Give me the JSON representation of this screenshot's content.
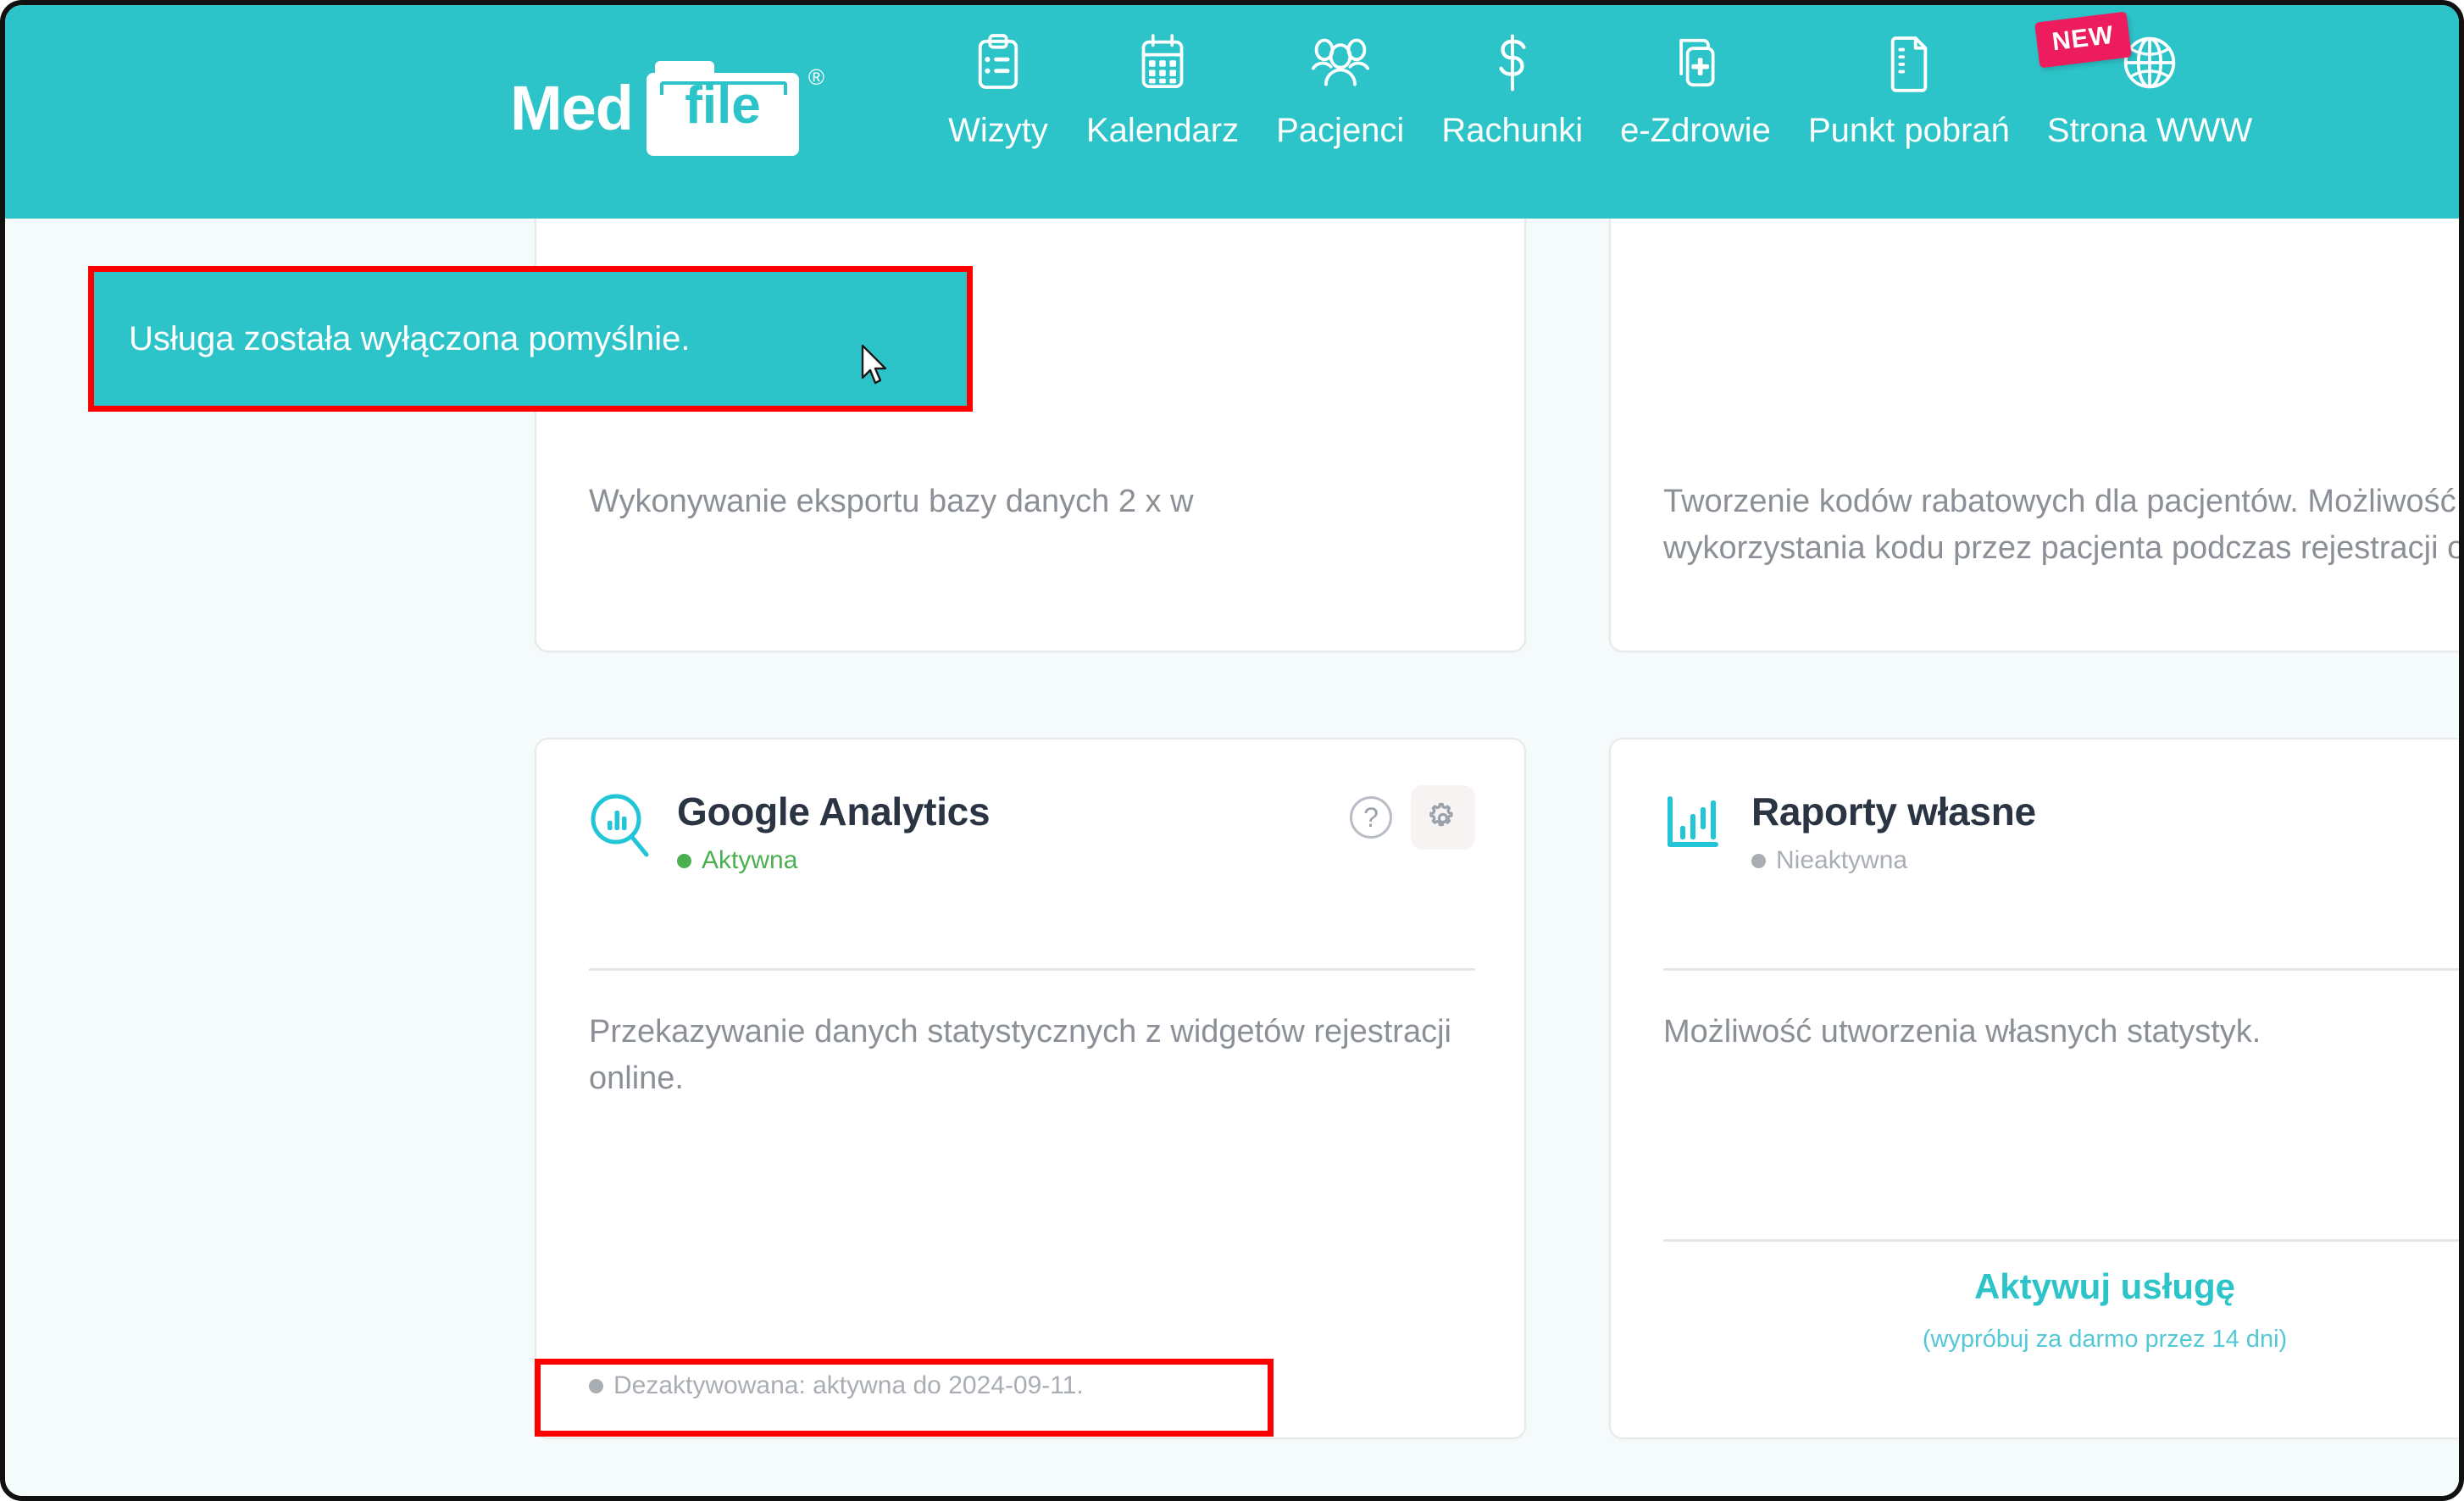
{
  "brand": {
    "logo_med": "Med",
    "logo_file": "file",
    "logo_trademark": "®",
    "accent_color": "#2cc4c9",
    "badge_color": "#ec1c5e",
    "annotation_color": "#ff0000"
  },
  "nav": {
    "items": [
      {
        "label": "Wizyty",
        "icon": "clipboard-list-icon"
      },
      {
        "label": "Kalendarz",
        "icon": "calendar-icon"
      },
      {
        "label": "Pacjenci",
        "icon": "people-group-icon"
      },
      {
        "label": "Rachunki",
        "icon": "dollar-sign-icon"
      },
      {
        "label": "e-Zdrowie",
        "icon": "medical-card-plus-icon"
      },
      {
        "label": "Punkt pobrań",
        "icon": "document-lines-icon"
      },
      {
        "label": "Strona WWW",
        "icon": "globe-icon",
        "badge": "NEW"
      }
    ]
  },
  "toast": {
    "message": "Usługa została wyłączona pomyślnie.",
    "background": "#2cc4c9"
  },
  "cards": {
    "backup": {
      "description": "Wykonywanie eksportu bazy danych 2 x w"
    },
    "discount": {
      "description": "Tworzenie kodów rabatowych dla pacjentów. Możliwość wykorzystania kodu przez pacjenta podczas rejestracji online."
    },
    "analytics": {
      "title": "Google Analytics",
      "icon": "analytics-search-icon",
      "status": "Aktywna",
      "status_color": "#4caf50",
      "help_icon": "question-circle-icon",
      "settings_icon": "gear-icon",
      "description": "Przekazywanie danych statystycznych z widgetów rejestracji online.",
      "footer_status": "Dezaktywowana: aktywna do 2024-09-11."
    },
    "reports": {
      "title": "Raporty własne",
      "icon": "bar-chart-icon",
      "status": "Nieaktywna",
      "status_color": "#a9aeb4",
      "description": "Możliwość utworzenia własnych statystyk.",
      "activate_label": "Aktywuj usługę",
      "activate_sub": "(wypróbuj za darmo przez 14 dni)"
    }
  }
}
